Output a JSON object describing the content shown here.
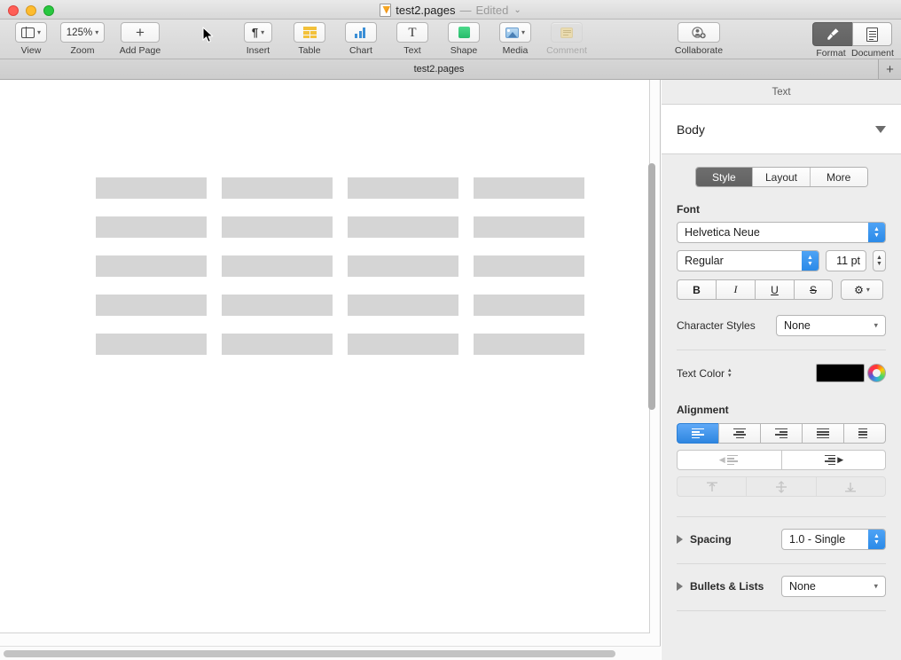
{
  "window": {
    "title_filename": "test2.pages",
    "title_separator": "—",
    "title_status": "Edited",
    "title_chevron": "⌄",
    "traffic_lights": [
      "close",
      "minimize",
      "zoom"
    ]
  },
  "toolbar": {
    "left_items": [
      {
        "label": "View",
        "icon": "sidebar-view-icon",
        "has_chevron": true
      },
      {
        "label": "Zoom",
        "icon": "zoom-percent",
        "value": "125%",
        "has_chevron": true
      },
      {
        "label": "Add Page",
        "icon": "plus-icon",
        "has_chevron": false
      }
    ],
    "center_items": [
      {
        "label": "Insert",
        "icon": "pilcrow-icon",
        "has_chevron": true,
        "enabled": true
      },
      {
        "label": "Table",
        "icon": "table-icon",
        "has_chevron": false,
        "enabled": true
      },
      {
        "label": "Chart",
        "icon": "chart-icon",
        "has_chevron": false,
        "enabled": true
      },
      {
        "label": "Text",
        "icon": "text-icon",
        "has_chevron": false,
        "enabled": true
      },
      {
        "label": "Shape",
        "icon": "shape-icon",
        "has_chevron": false,
        "enabled": true
      },
      {
        "label": "Media",
        "icon": "media-icon",
        "has_chevron": true,
        "enabled": true
      },
      {
        "label": "Comment",
        "icon": "comment-icon",
        "has_chevron": false,
        "enabled": false
      }
    ],
    "collaborate": {
      "label": "Collaborate",
      "icon": "collaborate-icon"
    },
    "right_segments": [
      {
        "label": "Format",
        "icon": "format-brush-icon",
        "active": true
      },
      {
        "label": "Document",
        "icon": "document-icon",
        "active": false
      }
    ]
  },
  "tabbar": {
    "tab_label": "test2.pages",
    "add_tab_label": "+"
  },
  "document": {
    "placeholder_rows": 5,
    "placeholder_cols": 4,
    "placeholder_color": "#d5d5d5"
  },
  "inspector": {
    "header": "Text",
    "paragraph_style": "Body",
    "tabs": [
      {
        "label": "Style",
        "active": true
      },
      {
        "label": "Layout",
        "active": false
      },
      {
        "label": "More",
        "active": false
      }
    ],
    "font": {
      "section_title": "Font",
      "family": "Helvetica Neue",
      "weight": "Regular",
      "size": "11 pt",
      "buttons": [
        {
          "label": "B",
          "name": "bold"
        },
        {
          "label": "I",
          "name": "italic"
        },
        {
          "label": "U",
          "name": "underline"
        },
        {
          "label": "S",
          "name": "strikethrough"
        }
      ],
      "gear_label": "⚙"
    },
    "character_styles": {
      "label": "Character Styles",
      "value": "None"
    },
    "text_color": {
      "label": "Text Color",
      "swatch": "#000000"
    },
    "alignment": {
      "section_title": "Alignment",
      "buttons": [
        {
          "name": "align-left",
          "active": true
        },
        {
          "name": "align-center",
          "active": false
        },
        {
          "name": "align-right",
          "active": false
        },
        {
          "name": "align-justify",
          "active": false
        },
        {
          "name": "align-text-direction",
          "active": false
        }
      ],
      "indent_buttons": [
        {
          "name": "decrease-indent",
          "enabled": false
        },
        {
          "name": "increase-indent",
          "enabled": true
        }
      ],
      "vertical_buttons": [
        {
          "name": "align-top",
          "enabled": false
        },
        {
          "name": "align-middle",
          "enabled": false
        },
        {
          "name": "align-bottom",
          "enabled": false
        }
      ]
    },
    "spacing": {
      "label": "Spacing",
      "value": "1.0 - Single"
    },
    "bullets": {
      "label": "Bullets & Lists",
      "value": "None"
    }
  },
  "colors": {
    "accent_blue": "#2e86e0",
    "toolbar_bg": "#dcdcdc",
    "inspector_bg": "#ededed",
    "placeholder_gray": "#d5d5d5"
  }
}
